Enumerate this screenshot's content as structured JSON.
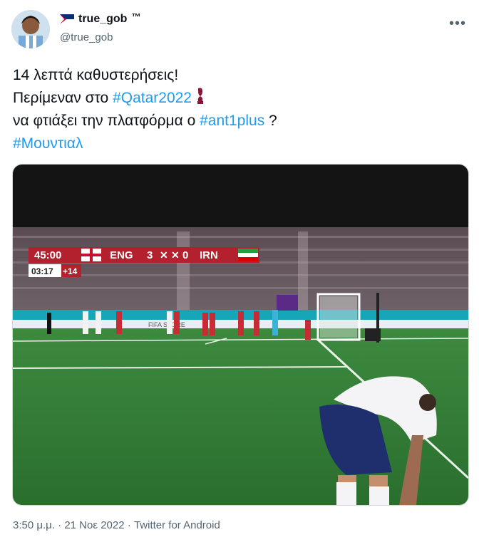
{
  "author": {
    "display_name": "true_gob",
    "trademark": "™",
    "handle": "@true_gob",
    "flag_icon": "flag-icon"
  },
  "tweet": {
    "line1": "14 λεπτά καθυστερήσεις!",
    "line2_text": "Περίμεναν στο ",
    "line2_hashtag": "#Qatar2022",
    "line3_text": "να φτιάξει την πλατφόρμα ο ",
    "line3_hashtag": "#ant1plus",
    "line3_suffix": " ?",
    "line4_hashtag": "#Μουντιαλ"
  },
  "media": {
    "scoreboard": {
      "time": "45:00",
      "home": "ENG",
      "home_score": "3",
      "away_score": "0",
      "away": "IRN",
      "stoppage_clock": "03:17",
      "added_time": "+14"
    },
    "board_text": "FIFA STORE"
  },
  "footer": {
    "time": "3:50 μ.μ.",
    "date": "21 Νοε 2022",
    "client": "Twitter for Android",
    "separator": "·"
  },
  "colors": {
    "link": "#1d9bf0",
    "secondary_text": "#536471",
    "pitch": "#2f7a36",
    "score_red": "#b3202e"
  }
}
